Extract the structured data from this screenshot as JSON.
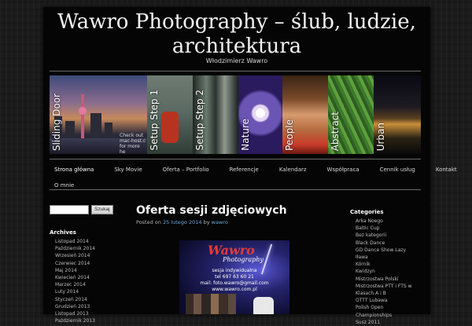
{
  "site": {
    "title": "Wawro Photography – ślub, ludzie, architektura",
    "description": "Włodzimierz Wawro"
  },
  "slider": {
    "panels": [
      {
        "label": "Sliding Door",
        "image": "city-skyline-night"
      },
      {
        "label": "Setup Step 1",
        "image": "red-lamp"
      },
      {
        "label": "Setup Step 2",
        "image": "trees-forest"
      },
      {
        "label": "Nature",
        "image": "purple-flower"
      },
      {
        "label": "People",
        "image": "smiling-child"
      },
      {
        "label": "Abstract",
        "image": "green-grass"
      },
      {
        "label": "Urban",
        "image": "night-city"
      }
    ],
    "note_line1": "Check out",
    "note_line2": "mac-host.c",
    "note_line3": "for more he"
  },
  "nav": {
    "row1": [
      "Strona główna",
      "Sky Movie",
      "Oferta – Portfolio",
      "Referencje",
      "Kalendarz",
      "Współpraca",
      "Cennik usług",
      "Kontakt"
    ],
    "row2": [
      "O mnie"
    ],
    "active_index": 0
  },
  "search": {
    "placeholder": "",
    "button_label": "Szukaj"
  },
  "archives": {
    "title": "Archives",
    "items": [
      "Listopad 2014",
      "Październik 2014",
      "Wrzesień 2014",
      "Czerwiec 2014",
      "Maj 2014",
      "Kwiecień 2014",
      "Marzec 2014",
      "Luty 2014",
      "Styczeń 2014",
      "Grudzień 2013",
      "Listopad 2013",
      "Październik 2013"
    ]
  },
  "post": {
    "title": "Oferta sesji zdjęciowych",
    "meta_posted_on": "Posted on",
    "meta_date": "25 lutego 2014",
    "meta_by": "by",
    "meta_author": "wawro",
    "flyer": {
      "logo": "Wawro",
      "logo_sub": "Photography",
      "line1": "sesja indywidualna",
      "line2": "tel 697 63 60 21",
      "line3": "mail: foto.wawro@gmail.com",
      "line4": "www.wawro.com.pl"
    }
  },
  "categories": {
    "title": "Categories",
    "items": [
      "Arka Noego",
      "Baltic Cup",
      "Bez kategorii",
      "Black Dance",
      "GD Dance Show Lazy",
      "Iława",
      "Kórnik",
      "Kwidzyn",
      "Mistrzostwa Polski",
      "Mistrzostwa PTT i FTS w",
      "Klasach A i B",
      "OTTT Lubawa",
      "Polish Open",
      "Championships",
      "Susz 2011"
    ]
  },
  "colors": {
    "background": "#1b1b1b",
    "content_bg": "#050505",
    "link": "#6ba6d8",
    "text": "#cfcfcf"
  }
}
